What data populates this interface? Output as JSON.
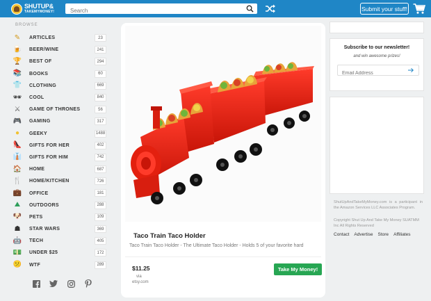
{
  "header": {
    "logo_line1": "SHUTUP&",
    "logo_line2": "TAKEMYMONEY!",
    "search_placeholder": "Search",
    "submit_label": "Submit your stuff!",
    "bar_color": "#1f86c6"
  },
  "sidebar": {
    "heading": "BROWSE",
    "items": [
      {
        "label": "ARTICLES",
        "count": "23",
        "icon": "pencil-icon"
      },
      {
        "label": "BEER/WINE",
        "count": "241",
        "icon": "beer-icon"
      },
      {
        "label": "BEST OF",
        "count": "294",
        "icon": "trophy-icon"
      },
      {
        "label": "BOOKS",
        "count": "60",
        "icon": "books-icon"
      },
      {
        "label": "CLOTHING",
        "count": "669",
        "icon": "shirt-icon"
      },
      {
        "label": "COOL",
        "count": "840",
        "icon": "sunglasses-icon"
      },
      {
        "label": "GAME OF THRONES",
        "count": "56",
        "icon": "swords-icon"
      },
      {
        "label": "GAMING",
        "count": "317",
        "icon": "gamepad-icon"
      },
      {
        "label": "GEEKY",
        "count": "1488",
        "icon": "pacman-icon"
      },
      {
        "label": "GIFTS FOR HER",
        "count": "402",
        "icon": "heels-icon"
      },
      {
        "label": "GIFTS FOR HIM",
        "count": "742",
        "icon": "tie-icon"
      },
      {
        "label": "HOME",
        "count": "687",
        "icon": "house-icon"
      },
      {
        "label": "HOME/KITCHEN",
        "count": "726",
        "icon": "kitchen-icon"
      },
      {
        "label": "OFFICE",
        "count": "181",
        "icon": "briefcase-icon"
      },
      {
        "label": "OUTDOORS",
        "count": "288",
        "icon": "mountain-icon"
      },
      {
        "label": "PETS",
        "count": "109",
        "icon": "dog-icon"
      },
      {
        "label": "STAR WARS",
        "count": "369",
        "icon": "stormtrooper-icon"
      },
      {
        "label": "TECH",
        "count": "405",
        "icon": "robot-icon"
      },
      {
        "label": "UNDER $25",
        "count": "172",
        "icon": "money-icon"
      },
      {
        "label": "WTF",
        "count": "289",
        "icon": "confused-face-icon"
      }
    ],
    "socials": [
      "facebook-icon",
      "twitter-icon",
      "instagram-icon",
      "pinterest-icon"
    ]
  },
  "product": {
    "title": "Taco Train Taco Holder",
    "subtitle": "Taco Train Taco Holder - The Ultimate Taco Holder - Holds 5 of your favorite hard",
    "price": "$11.25",
    "via": "via",
    "source": "etsy.com",
    "buy_label": "Take My Money!",
    "buy_color": "#27a653"
  },
  "newsletter": {
    "title": "Subscribe to our newsletter!",
    "subtitle": "and win awesome prizes!",
    "placeholder": "Email Address"
  },
  "footer": {
    "disclaimer": "ShutUpAndTakeMyMoney.com is a participant in the Amazon Services LLC Associates Program.",
    "copyright": "Copyright Shut Up And Take My Money SUATMM Inc All Rights Reserved",
    "links": [
      "Contact",
      "Advertise",
      "Store",
      "Affiliates"
    ]
  }
}
